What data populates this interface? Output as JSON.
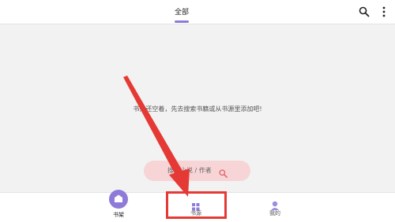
{
  "header": {
    "tab_all": "全部",
    "icons": [
      "search-icon",
      "more-vertical-icon"
    ]
  },
  "main": {
    "empty_message": "书架还空着，先去搜索书籍或从书源里添加吧!",
    "search_pill_label": "搜索小说 / 作者"
  },
  "bottom_nav": {
    "items": [
      {
        "label": "书架",
        "icon": "bookshelf-icon"
      },
      {
        "label": "书源",
        "icon": "book-source-icon"
      },
      {
        "label": "我的",
        "icon": "profile-icon"
      }
    ]
  },
  "colors": {
    "accent": "#8e7bd9",
    "annotation": "#e53935",
    "pill": "#f7d5d6"
  }
}
